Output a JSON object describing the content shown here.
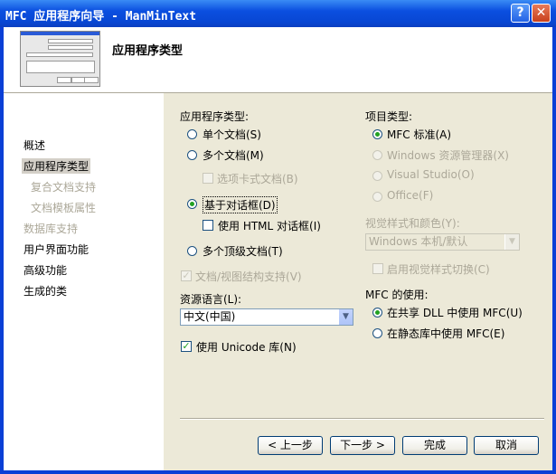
{
  "window": {
    "title": "MFC 应用程序向导 - ManMinText"
  },
  "header": {
    "title": "应用程序类型"
  },
  "nav": {
    "items": [
      {
        "label": "概述"
      },
      {
        "label": "应用程序类型"
      },
      {
        "label": "复合文档支持"
      },
      {
        "label": "文档模板属性"
      },
      {
        "label": "数据库支持"
      },
      {
        "label": "用户界面功能"
      },
      {
        "label": "高级功能"
      },
      {
        "label": "生成的类"
      }
    ]
  },
  "app_type": {
    "heading": "应用程序类型:",
    "single_doc": "单个文档(S)",
    "multi_doc": "多个文档(M)",
    "tabbed_doc": "选项卡式文档(B)",
    "dialog_based": "基于对话框(D)",
    "html_dialog": "使用 HTML 对话框(I)",
    "multi_top": "多个顶级文档(T)",
    "doc_view": "文档/视图结构支持(V)"
  },
  "resource_lang": {
    "label": "资源语言(L):",
    "value": "中文(中国)"
  },
  "unicode": {
    "label": "使用 Unicode 库(N)"
  },
  "project_type": {
    "heading": "项目类型:",
    "mfc_std": "MFC 标准(A)",
    "win_explorer": "Windows 资源管理器(X)",
    "visual_studio": "Visual Studio(O)",
    "office": "Office(F)"
  },
  "visual_style": {
    "label": "视觉样式和颜色(Y):",
    "value": "Windows 本机/默认",
    "enable_toggle": "启用视觉样式切换(C)"
  },
  "mfc_use": {
    "heading": "MFC 的使用:",
    "shared_dll": "在共享 DLL 中使用 MFC(U)",
    "static_lib": "在静态库中使用 MFC(E)"
  },
  "buttons": {
    "back": "< 上一步",
    "next": "下一步 >",
    "finish": "完成",
    "cancel": "取消"
  },
  "icons": {
    "help": "?",
    "close": "✕",
    "check": "✓",
    "dropdown": "▼"
  },
  "colors": {
    "titlebar": "#0b4fe0",
    "dialog_bg": "#ece9d8",
    "radio_dot": "#21a121"
  }
}
